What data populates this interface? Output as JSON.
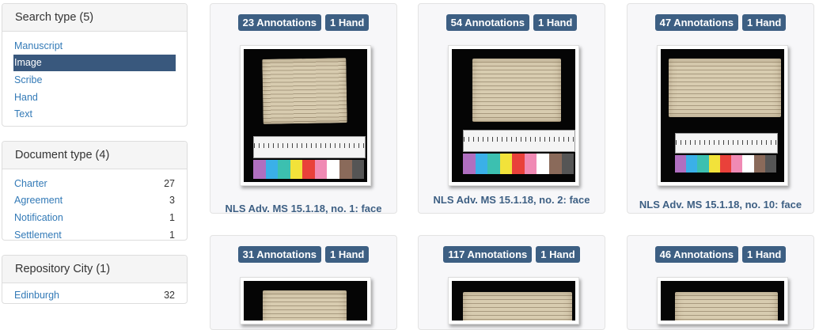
{
  "sidebar": {
    "search_type": {
      "title": "Search type (5)",
      "items": [
        {
          "label": "Manuscript",
          "active": false
        },
        {
          "label": "Image",
          "active": true
        },
        {
          "label": "Scribe",
          "active": false
        },
        {
          "label": "Hand",
          "active": false
        },
        {
          "label": "Text",
          "active": false
        }
      ]
    },
    "document_type": {
      "title": "Document type (4)",
      "items": [
        {
          "label": "Charter",
          "count": "27"
        },
        {
          "label": "Agreement",
          "count": "3"
        },
        {
          "label": "Notification",
          "count": "1"
        },
        {
          "label": "Settlement",
          "count": "1"
        }
      ]
    },
    "repository_city": {
      "title": "Repository City (1)",
      "items": [
        {
          "label": "Edinburgh",
          "count": "32"
        }
      ]
    }
  },
  "results": [
    {
      "annotations": "23 Annotations",
      "hands": "1 Hand",
      "caption": "NLS Adv. MS 15.1.18, no. 1: face"
    },
    {
      "annotations": "54 Annotations",
      "hands": "1 Hand",
      "caption": "NLS Adv. MS 15.1.18, no. 2: face"
    },
    {
      "annotations": "47 Annotations",
      "hands": "1 Hand",
      "caption": "NLS Adv. MS 15.1.18, no. 10: face"
    },
    {
      "annotations": "31 Annotations",
      "hands": "1 Hand",
      "caption": ""
    },
    {
      "annotations": "117 Annotations",
      "hands": "1 Hand",
      "caption": ""
    },
    {
      "annotations": "46 Annotations",
      "hands": "1 Hand",
      "caption": ""
    }
  ],
  "colors": {
    "badge": "#3d5f83",
    "active_facet": "#39587d",
    "link": "#337ab7"
  }
}
